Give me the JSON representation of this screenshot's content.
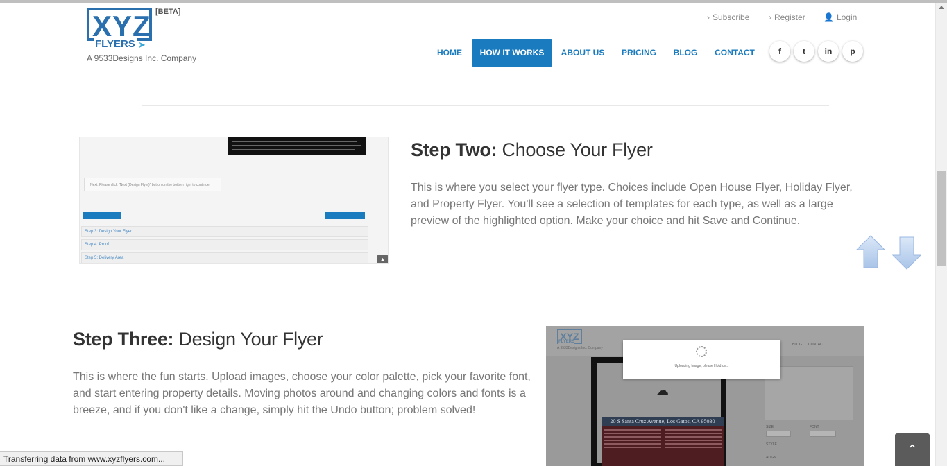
{
  "header": {
    "logo": {
      "text": "XYZ",
      "sub": "FLYERS",
      "beta": "[BETA]",
      "tagline": "A 9533Designs Inc. Company"
    },
    "util_links": [
      {
        "label": "Subscribe",
        "icon": "chevron-right-icon"
      },
      {
        "label": "Register",
        "icon": "chevron-right-icon"
      },
      {
        "label": "Login",
        "icon": "user-icon"
      }
    ],
    "nav": [
      {
        "label": "HOME",
        "active": false
      },
      {
        "label": "HOW IT WORKS",
        "active": true
      },
      {
        "label": "ABOUT US",
        "active": false
      },
      {
        "label": "PRICING",
        "active": false
      },
      {
        "label": "BLOG",
        "active": false
      },
      {
        "label": "CONTACT",
        "active": false
      }
    ],
    "social": [
      {
        "icon": "facebook-icon",
        "glyph": "f"
      },
      {
        "icon": "twitter-icon",
        "glyph": "t"
      },
      {
        "icon": "linkedin-icon",
        "glyph": "in"
      },
      {
        "icon": "pinterest-icon",
        "glyph": "p"
      }
    ]
  },
  "steps": [
    {
      "heading_bold": "Step Two:",
      "heading_rest": " Choose Your Flyer",
      "text": "This is where you select your flyer type. Choices include Open House Flyer, Holiday Flyer, and Property Flyer. You'll see a selection of templates for each type, as well as a large preview of the highlighted option. Make your choice and hit Save and Continue.",
      "screenshot": {
        "note": "Next: Please click \"Next (Design Flyer)\" button on the bottom right to continue.",
        "steps": [
          "Step 3: Design Your Flyer",
          "Step 4: Proof",
          "Step 5: Delivery Area"
        ]
      }
    },
    {
      "heading_bold": "Step Three:",
      "heading_rest": " Design Your Flyer",
      "text": "This is where the fun starts. Upload images, choose your color palette, pick your favorite font, and start entering property details. Moving photos around and changing colors and fonts is a breeze, and if you don't like a change, simply hit the Undo button; problem solved!",
      "screenshot": {
        "logo": "XYZ",
        "logo_sub": "FLYERS",
        "tagline": "A 9533Designs Inc. Company",
        "modal_text": "Uploading Image, please Hold on...",
        "address": "20 S Santa Cruz Avenue, Los Gatos, CA 95030",
        "nav": [
          "BLOG",
          "CONTACT"
        ],
        "labels": [
          "SIZE",
          "FONT",
          "STYLE",
          "ALIGN"
        ]
      }
    }
  ],
  "status_bar": "Transferring data from www.xyzflyers.com...",
  "back_to_top": "chevron-up-icon",
  "colors": {
    "brand": "#1a7bbf",
    "logo": "#2a6fae",
    "text": "#777777",
    "heading": "#333333"
  }
}
